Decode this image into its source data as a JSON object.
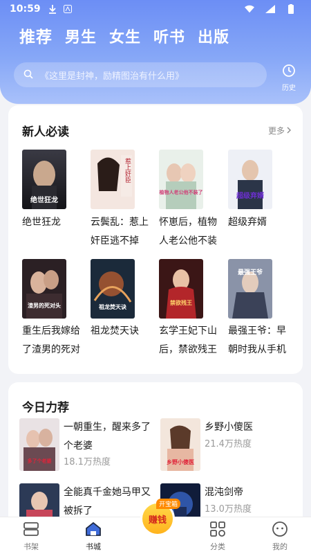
{
  "status": {
    "time": "10:59"
  },
  "tabs": [
    "推荐",
    "男生",
    "女生",
    "听书",
    "出版"
  ],
  "search": {
    "placeholder": "《这里是封神，励精图治有什么用》"
  },
  "history": {
    "label": "历史"
  },
  "new_reader": {
    "title": "新人必读",
    "more": "更多",
    "books": [
      {
        "title": "绝世狂龙",
        "cover_text": "绝世狂龙"
      },
      {
        "title": "云鬓乱：惹上奸臣逃不掉",
        "cover_text": "惹上奸臣"
      },
      {
        "title": "怀崽后，植物人老公他不装了",
        "cover_text": "植物人老公他不装了"
      },
      {
        "title": "超级弃婿",
        "cover_text": "超级弃婿"
      },
      {
        "title": "重生后我嫁给了渣男的死对头",
        "cover_text": "渣男的死对头"
      },
      {
        "title": "祖龙焚天诀",
        "cover_text": "祖龙焚天诀"
      },
      {
        "title": "玄学王妃下山后，禁欲残王宠上天",
        "cover_text": "禁欲残王"
      },
      {
        "title": "最强王爷：早朝时我从手机里召唤出千军万马",
        "cover_text": "最强王爷"
      }
    ]
  },
  "today": {
    "title": "今日力荐",
    "items": [
      {
        "title": "一朝重生，醒来多了个老婆",
        "heat": "18.1万热度",
        "cover_text": "多了个老婆"
      },
      {
        "title": "乡野小傻医",
        "heat": "21.4万热度",
        "cover_text": "乡野小傻医"
      },
      {
        "title": "全能真千金她马甲又被拆了",
        "heat": "",
        "cover_text": ""
      },
      {
        "title": "混沌剑帝",
        "heat": "13.0万热度",
        "cover_text": ""
      }
    ]
  },
  "nav": {
    "items": [
      "书架",
      "书城",
      "赚钱",
      "分类",
      "我的"
    ],
    "earn_badge": "开宝箱"
  },
  "colors": {
    "accent": "#6c8ef5",
    "text": "#1b1b1b",
    "muted": "#9a9a9a"
  }
}
